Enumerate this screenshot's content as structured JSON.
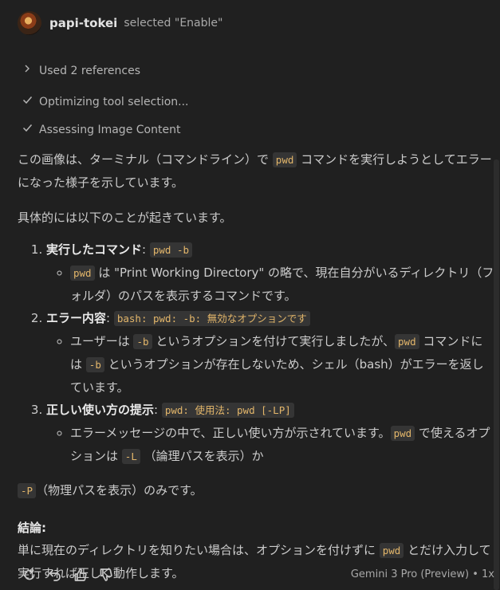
{
  "header": {
    "username": "papi-tokei",
    "action": "selected \"Enable\""
  },
  "steps": [
    {
      "icon": "chevron-right-icon",
      "label": "Used 2 references"
    },
    {
      "icon": "check-icon",
      "label": "Optimizing tool selection..."
    },
    {
      "icon": "check-icon",
      "label": "Assessing Image Content"
    }
  ],
  "answer": {
    "p1_a": "この画像は、ターミナル（コマンドライン）で",
    "p1_code": "pwd",
    "p1_b": "コマンドを実行しようとしてエラーになった様子を示しています。",
    "p2": "具体的には以下のことが起きています。",
    "item1_title": "実行したコマンド",
    "item1_code": "pwd -b",
    "item1_sub_code": "pwd",
    "item1_sub_text": "は \"Print Working Directory\" の略で、現在自分がいるディレクトリ（フォルダ）のパスを表示するコマンドです。",
    "item2_title": "エラー内容",
    "item2_code": "bash: pwd: -b: 無効なオプションです",
    "item2_sub_a": "ユーザーは",
    "item2_sub_code1": "-b",
    "item2_sub_b": "というオプションを付けて実行しましたが、",
    "item2_sub_code2": "pwd",
    "item2_sub_c": "コマンドには",
    "item2_sub_code3": "-b",
    "item2_sub_d": "というオプションが存在しないため、シェル（bash）がエラーを返しています。",
    "item3_title": "正しい使い方の提示",
    "item3_code": "pwd: 使用法: pwd [-LP]",
    "item3_sub_a": "エラーメッセージの中で、正しい使い方が示されています。",
    "item3_sub_code1": "pwd",
    "item3_sub_b": "で使えるオプションは",
    "item3_sub_code2": "-L",
    "item3_sub_c": "（論理パスを表示）か",
    "p3_code": "-P",
    "p3_text": "（物理パスを表示）のみです。",
    "conclusion_title": "結論:",
    "conclusion_a": "単に現在のディレクトリを知りたい場合は、オプションを付けずに",
    "conclusion_code": "pwd",
    "conclusion_b": "とだけ入力して実行すれば正しく動作します。"
  },
  "footer": {
    "icons": [
      "retry-icon",
      "undo-icon",
      "thumbs-up-icon",
      "thumbs-down-icon"
    ],
    "model": "Gemini 3 Pro (Preview) • 1x"
  }
}
